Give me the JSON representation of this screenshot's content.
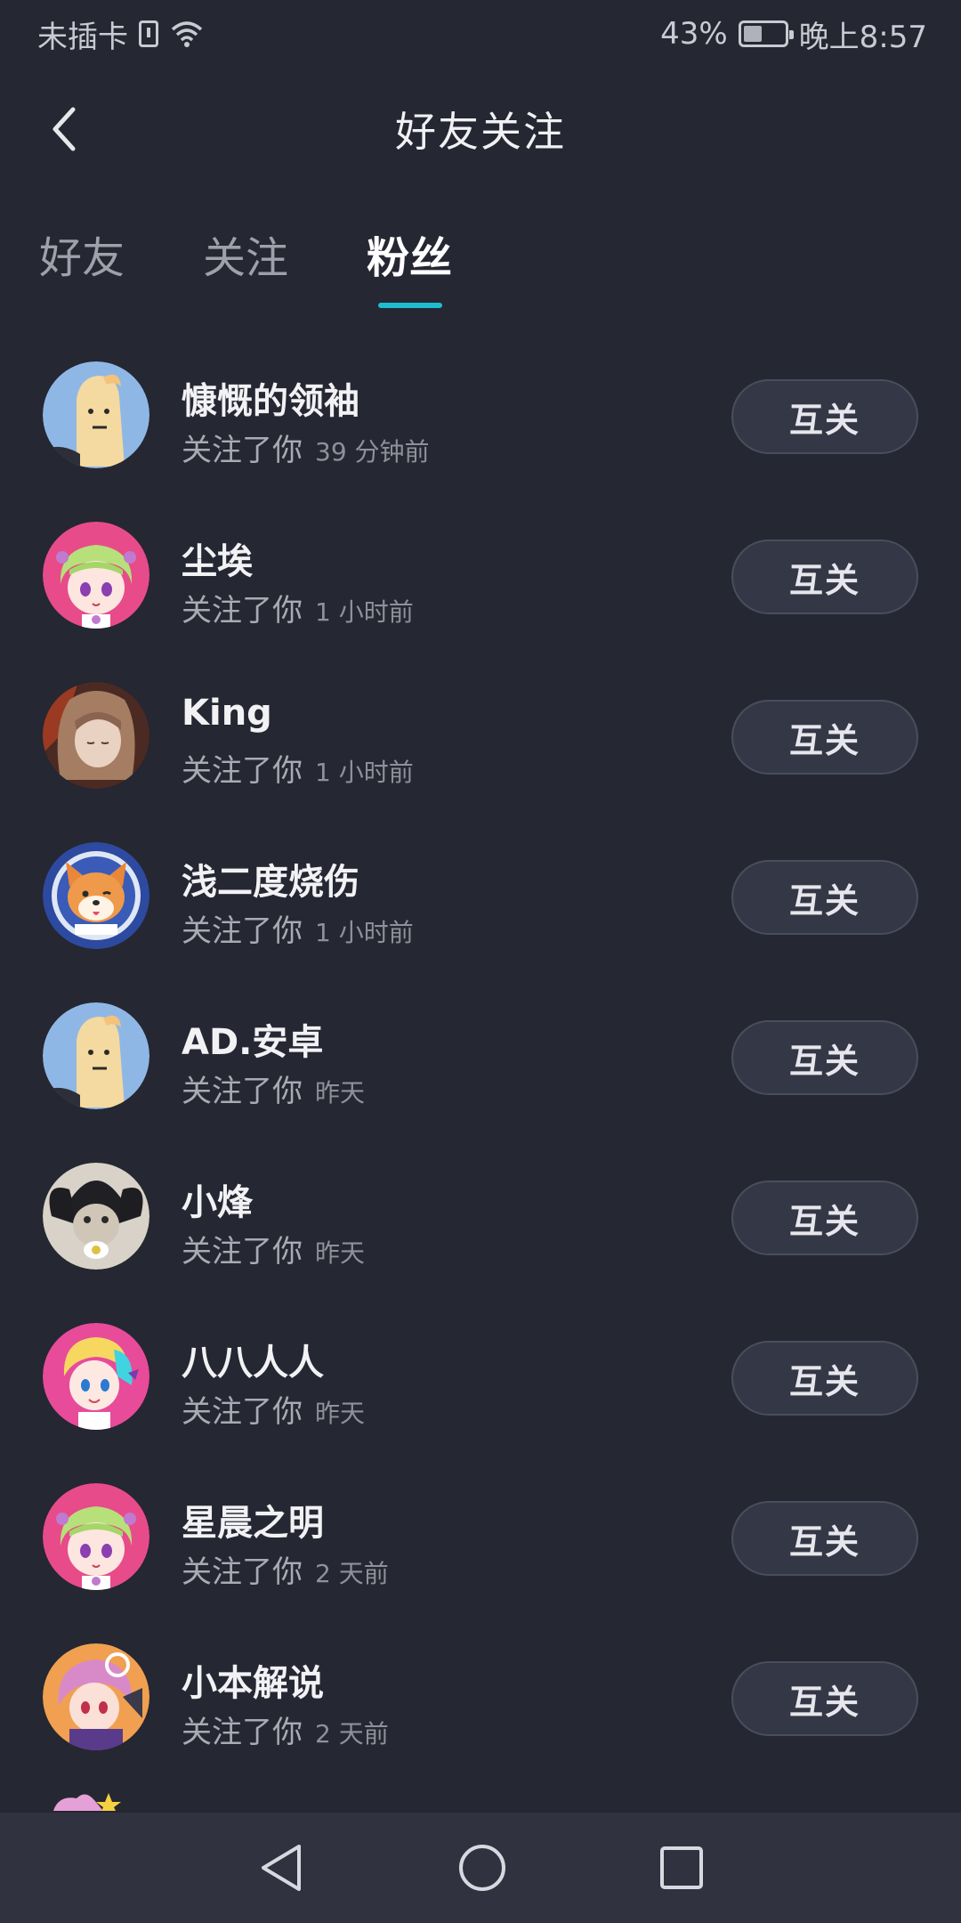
{
  "status_bar": {
    "carrier": "未插卡",
    "battery": "43%",
    "time": "晚上8:57"
  },
  "header": {
    "title": "好友关注",
    "back_icon": "chevron-left-icon"
  },
  "tabs": [
    {
      "label": "好友",
      "active": false
    },
    {
      "label": "关注",
      "active": false
    },
    {
      "label": "粉丝",
      "active": true
    }
  ],
  "accent_color": "#20bcd0",
  "fans": [
    {
      "name": "慷慨的领袖",
      "action": "关注了你",
      "time": "39 分钟前",
      "button": "互关",
      "avatar": "bean-avatar"
    },
    {
      "name": "尘埃",
      "action": "关注了你",
      "time": "1 小时前",
      "button": "互关",
      "avatar": "anime-girl-green-hair-avatar"
    },
    {
      "name": "King",
      "action": "关注了你",
      "time": "1 小时前",
      "button": "互关",
      "avatar": "anime-girl-brown-hair-avatar"
    },
    {
      "name": "浅二度烧伤",
      "action": "关注了你",
      "time": "1 小时前",
      "button": "互关",
      "avatar": "shiba-dog-avatar"
    },
    {
      "name": "AD.安卓",
      "action": "关注了你",
      "time": "昨天",
      "button": "互关",
      "avatar": "bean-avatar"
    },
    {
      "name": "小烽",
      "action": "关注了你",
      "time": "昨天",
      "button": "互关",
      "avatar": "cat-photo-avatar"
    },
    {
      "name": "八八人人",
      "action": "关注了你",
      "time": "昨天",
      "button": "互关",
      "avatar": "anime-blonde-avatar"
    },
    {
      "name": "星晨之明",
      "action": "关注了你",
      "time": "2 天前",
      "button": "互关",
      "avatar": "anime-girl-green-hair-avatar"
    },
    {
      "name": "小本解说",
      "action": "关注了你",
      "time": "2 天前",
      "button": "互关",
      "avatar": "anime-pink-hair-avatar"
    }
  ],
  "nav_bar": [
    "back-triangle-icon",
    "home-circle-icon",
    "recents-square-icon"
  ]
}
